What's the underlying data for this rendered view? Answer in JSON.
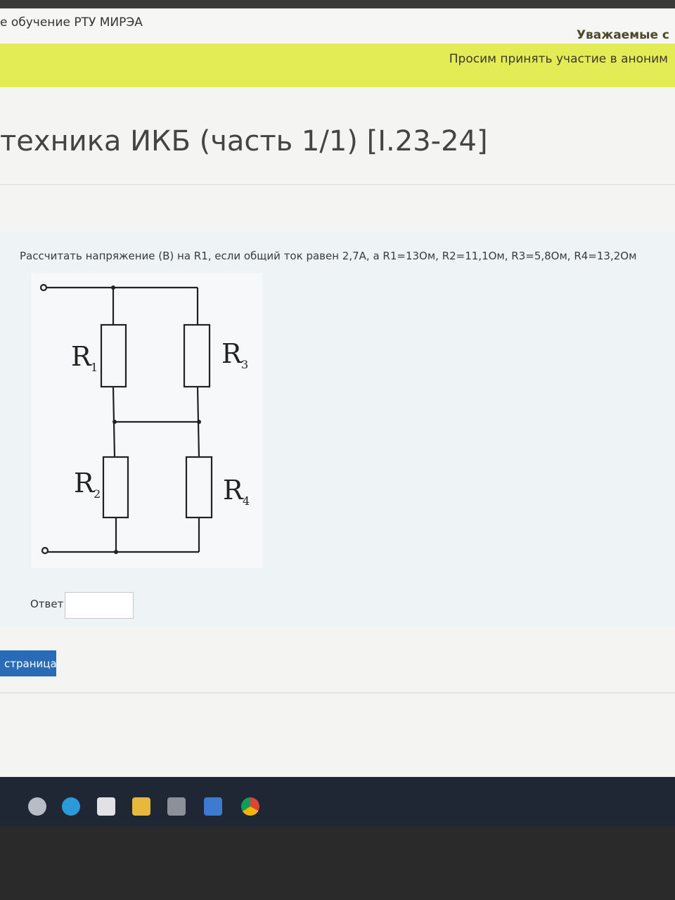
{
  "header": {
    "site_name": "е обучение РТУ МИРЭА"
  },
  "notice": {
    "line1": "Уважаемые с",
    "line2": "Просим принять участие в аноним"
  },
  "page": {
    "title": "техника ИКБ (часть 1/1) [I.23-24]"
  },
  "question": {
    "text": "Рассчитать напряжение (В) на R1, если общий ток равен 2,7А, а R1=13Ом, R2=11,1Ом, R3=5,8Ом, R4=13,2Ом",
    "circuit": {
      "r1": "R",
      "r1_sub": "1",
      "r2": "R",
      "r2_sub": "2",
      "r3": "R",
      "r3_sub": "3",
      "r4": "R",
      "r4_sub": "4"
    },
    "answer_label": "Ответ:",
    "answer_value": ""
  },
  "nav": {
    "next_label": "страница"
  },
  "taskbar": {
    "icons": [
      "settings-icon",
      "edge-icon",
      "store-icon",
      "explorer-icon",
      "calculator-icon",
      "mail-icon",
      "chrome-icon"
    ]
  },
  "colors": {
    "notice_bg": "#e4ec55",
    "button_bg": "#2a6bb8",
    "taskbar_bg": "#1e2733"
  }
}
